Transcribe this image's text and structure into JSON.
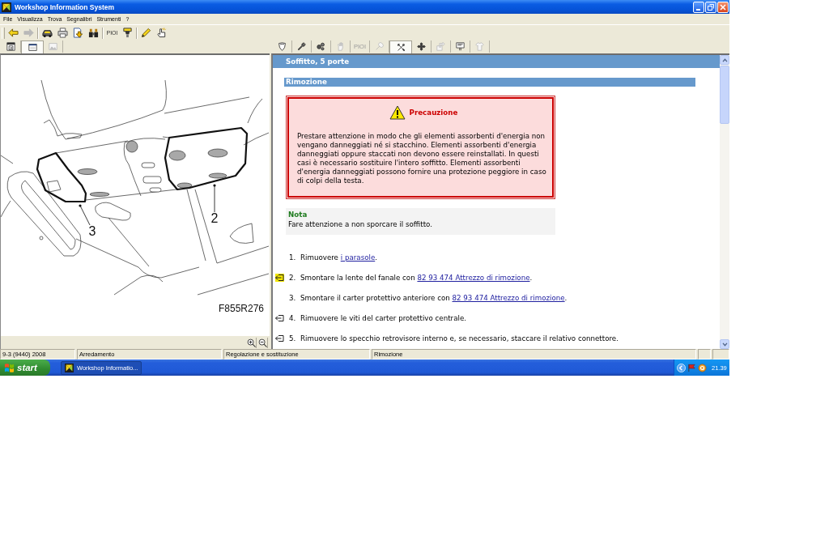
{
  "window": {
    "title": "Workshop Information System"
  },
  "menu": [
    "File",
    "Visualizza",
    "Trova",
    "Segnalibri",
    "Strumenti",
    "?"
  ],
  "toolbar": [
    [
      {
        "disabled": false
      },
      {
        "disabled": true
      }
    ],
    [
      {
        "disabled": false
      },
      {
        "disabled": false
      },
      {
        "disabled": false
      },
      {
        "disabled": false
      }
    ],
    [
      {
        "label": "PIOI",
        "disabled": false
      },
      {
        "disabled": false
      }
    ],
    [
      {
        "disabled": false
      },
      {
        "disabled": false
      }
    ]
  ],
  "left_tabs": [
    {
      "selected": false,
      "disabled": false
    },
    {
      "selected": true,
      "disabled": false
    },
    {
      "selected": false,
      "disabled": true
    }
  ],
  "right_tabs": [
    {
      "selected": false,
      "disabled": false
    },
    {
      "selected": false,
      "disabled": false
    },
    {
      "selected": false,
      "disabled": false
    },
    {
      "selected": false,
      "disabled": true
    },
    {
      "label": "PIOI",
      "selected": false,
      "disabled": true
    },
    {
      "selected": false,
      "disabled": true
    },
    {
      "selected": true,
      "disabled": false
    },
    {
      "selected": false,
      "disabled": false
    },
    {
      "selected": false,
      "disabled": true
    },
    {
      "selected": false,
      "disabled": false
    },
    {
      "selected": false,
      "disabled": true
    }
  ],
  "figure": {
    "callouts": [
      "3",
      "2"
    ],
    "code": "F855R276"
  },
  "document": {
    "title": "Soffitto, 5 porte",
    "section": "Rimozione",
    "caution": {
      "title": "Precauzione",
      "text": "Prestare attenzione in modo che gli elementi assorbenti d'energia non vengano danneggiati né si stacchino. Elementi assorbenti d'energia danneggiati oppure staccati non devono essere reinstallati. In questi casi è necessario sostituire l'intero soffitto. Elementi assorbenti d'energia danneggiati possono fornire una protezione peggiore in caso di colpi della testa."
    },
    "note": {
      "title": "Nota",
      "text": "Fare attenzione a non sporcare il soffitto."
    },
    "steps": [
      {
        "number": "1.",
        "marked": false,
        "highlighted": false,
        "parts": [
          {
            "kind": "text",
            "text": "Rimuovere "
          },
          {
            "kind": "link",
            "text": "i parasole"
          },
          {
            "kind": "text",
            "text": "."
          }
        ]
      },
      {
        "number": "2.",
        "marked": true,
        "highlighted": true,
        "parts": [
          {
            "kind": "text",
            "text": "Smontare la lente del fanale con "
          },
          {
            "kind": "link",
            "text": "82 93 474 Attrezzo di rimozione"
          },
          {
            "kind": "text",
            "text": "."
          }
        ]
      },
      {
        "number": "3.",
        "marked": false,
        "highlighted": false,
        "parts": [
          {
            "kind": "text",
            "text": "Smontare il carter protettivo anteriore con "
          },
          {
            "kind": "link",
            "text": "82 93 474 Attrezzo di rimozione"
          },
          {
            "kind": "text",
            "text": "."
          }
        ]
      },
      {
        "number": "4.",
        "marked": true,
        "highlighted": false,
        "parts": [
          {
            "kind": "text",
            "text": "Rimuovere le viti del carter protettivo centrale."
          }
        ]
      },
      {
        "number": "5.",
        "marked": true,
        "highlighted": false,
        "parts": [
          {
            "kind": "text",
            "text": "Rimuovere lo specchio retrovisore interno e, se necessario, staccare il relativo connettore."
          }
        ]
      }
    ]
  },
  "status_bar": [
    "9-3 (9440) 2008",
    "Arredamento",
    "Regolazione e sostituzione",
    "Rimozione"
  ],
  "taskbar": {
    "start": "start",
    "tasks": [
      {
        "label": "Workshop Informatio...",
        "selected": true
      }
    ],
    "clock": "21.39"
  }
}
